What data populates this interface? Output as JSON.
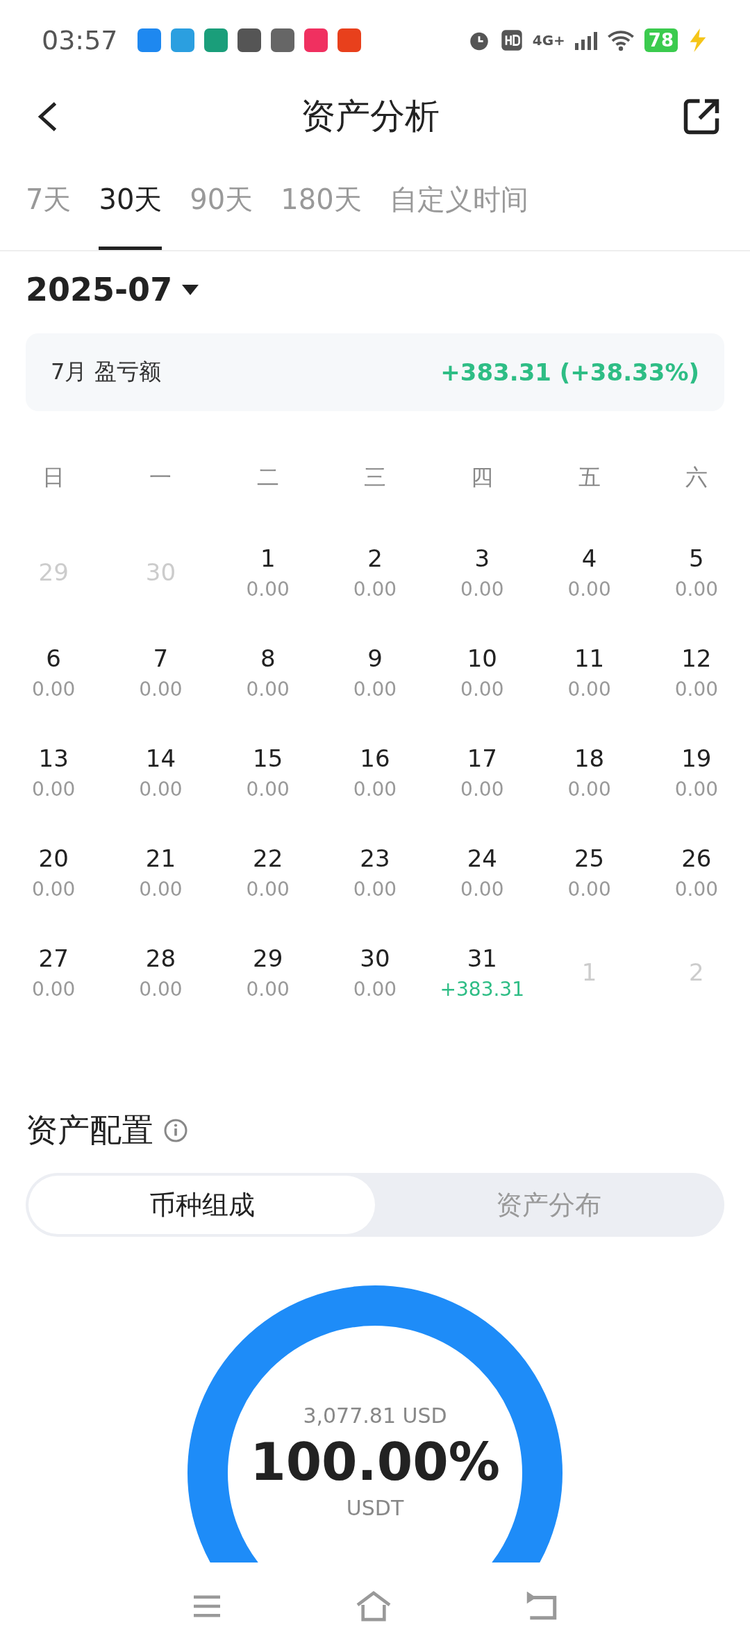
{
  "status_bar": {
    "time": "03:57",
    "network": "4G+",
    "battery": "78"
  },
  "header": {
    "title": "资产分析"
  },
  "tabs": [
    {
      "label": "7天",
      "selected": false
    },
    {
      "label": "30天",
      "selected": true
    },
    {
      "label": "90天",
      "selected": false
    },
    {
      "label": "180天",
      "selected": false
    },
    {
      "label": "自定义时间",
      "selected": false
    }
  ],
  "month": "2025-07",
  "summary": {
    "label": "7月 盈亏额",
    "value": "+383.31 (+38.33%)"
  },
  "weekdays": [
    "日",
    "一",
    "二",
    "三",
    "四",
    "五",
    "六"
  ],
  "calendar": [
    {
      "day": "29",
      "outside": true
    },
    {
      "day": "30",
      "outside": true
    },
    {
      "day": "1",
      "value": "0.00",
      "outside": false,
      "gain": false
    },
    {
      "day": "2",
      "value": "0.00",
      "outside": false,
      "gain": false
    },
    {
      "day": "3",
      "value": "0.00",
      "outside": false,
      "gain": false
    },
    {
      "day": "4",
      "value": "0.00",
      "outside": false,
      "gain": false
    },
    {
      "day": "5",
      "value": "0.00",
      "outside": false,
      "gain": false
    },
    {
      "day": "6",
      "value": "0.00",
      "outside": false,
      "gain": false
    },
    {
      "day": "7",
      "value": "0.00",
      "outside": false,
      "gain": false
    },
    {
      "day": "8",
      "value": "0.00",
      "outside": false,
      "gain": false
    },
    {
      "day": "9",
      "value": "0.00",
      "outside": false,
      "gain": false
    },
    {
      "day": "10",
      "value": "0.00",
      "outside": false,
      "gain": false
    },
    {
      "day": "11",
      "value": "0.00",
      "outside": false,
      "gain": false
    },
    {
      "day": "12",
      "value": "0.00",
      "outside": false,
      "gain": false
    },
    {
      "day": "13",
      "value": "0.00",
      "outside": false,
      "gain": false
    },
    {
      "day": "14",
      "value": "0.00",
      "outside": false,
      "gain": false
    },
    {
      "day": "15",
      "value": "0.00",
      "outside": false,
      "gain": false
    },
    {
      "day": "16",
      "value": "0.00",
      "outside": false,
      "gain": false
    },
    {
      "day": "17",
      "value": "0.00",
      "outside": false,
      "gain": false
    },
    {
      "day": "18",
      "value": "0.00",
      "outside": false,
      "gain": false
    },
    {
      "day": "19",
      "value": "0.00",
      "outside": false,
      "gain": false
    },
    {
      "day": "20",
      "value": "0.00",
      "outside": false,
      "gain": false
    },
    {
      "day": "21",
      "value": "0.00",
      "outside": false,
      "gain": false
    },
    {
      "day": "22",
      "value": "0.00",
      "outside": false,
      "gain": false
    },
    {
      "day": "23",
      "value": "0.00",
      "outside": false,
      "gain": false
    },
    {
      "day": "24",
      "value": "0.00",
      "outside": false,
      "gain": false
    },
    {
      "day": "25",
      "value": "0.00",
      "outside": false,
      "gain": false
    },
    {
      "day": "26",
      "value": "0.00",
      "outside": false,
      "gain": false
    },
    {
      "day": "27",
      "value": "0.00",
      "outside": false,
      "gain": false
    },
    {
      "day": "28",
      "value": "0.00",
      "outside": false,
      "gain": false
    },
    {
      "day": "29",
      "value": "0.00",
      "outside": false,
      "gain": false
    },
    {
      "day": "30",
      "value": "0.00",
      "outside": false,
      "gain": false
    },
    {
      "day": "31",
      "value": "+383.31",
      "outside": false,
      "gain": true
    },
    {
      "day": "1",
      "outside": true
    },
    {
      "day": "2",
      "outside": true
    }
  ],
  "allocation": {
    "title": "资产配置",
    "segments": [
      {
        "label": "币种组成",
        "selected": true
      },
      {
        "label": "资产分布",
        "selected": false
      }
    ],
    "donut": {
      "amount": "3,077.81 USD",
      "percent": "100.00%",
      "asset": "USDT"
    }
  }
}
